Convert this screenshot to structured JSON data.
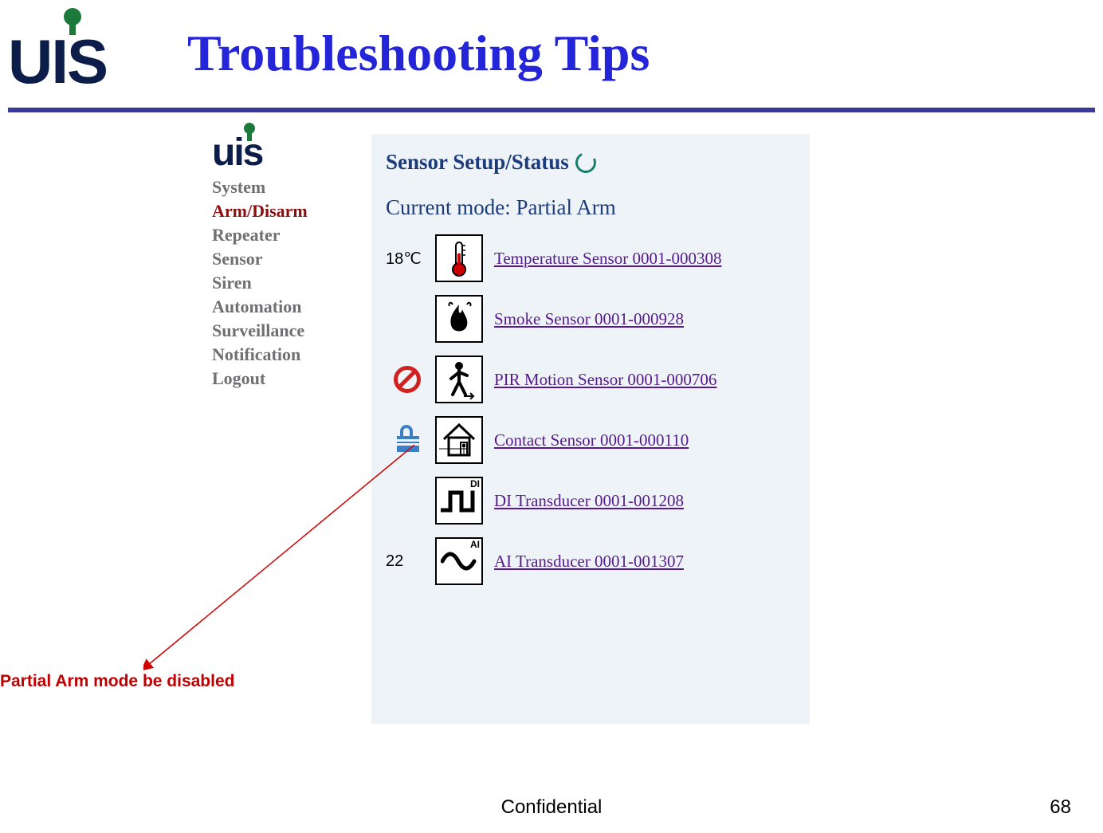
{
  "slide": {
    "title": "Troubleshooting Tips",
    "logo_text": "UIS",
    "footer_confidential": "Confidential",
    "page_number": "68"
  },
  "annotation": {
    "text": "Partial Arm mode be disabled"
  },
  "app": {
    "logo_text": "uis",
    "sidebar": {
      "items": [
        {
          "label": "System",
          "active": false
        },
        {
          "label": "Arm/Disarm",
          "active": true
        },
        {
          "label": "Repeater",
          "active": false
        },
        {
          "label": "Sensor",
          "active": false
        },
        {
          "label": "Siren",
          "active": false
        },
        {
          "label": "Automation",
          "active": false
        },
        {
          "label": "Surveillance",
          "active": false
        },
        {
          "label": "Notification",
          "active": false
        },
        {
          "label": "Logout",
          "active": false
        }
      ]
    },
    "panel": {
      "title": "Sensor Setup/Status",
      "mode_line": "Current mode: Partial Arm",
      "sensors": [
        {
          "status_text": "18℃",
          "status_icon": "",
          "icon": "thermometer-icon",
          "label": "Temperature Sensor 0001-000308"
        },
        {
          "status_text": "",
          "status_icon": "",
          "icon": "fire-icon",
          "label": "Smoke Sensor 0001-000928"
        },
        {
          "status_text": "",
          "status_icon": "prohibit",
          "icon": "motion-icon",
          "label": "PIR Motion Sensor 0001-000706"
        },
        {
          "status_text": "",
          "status_icon": "lock",
          "icon": "house-icon",
          "label": "Contact Sensor 0001-000110"
        },
        {
          "status_text": "",
          "status_icon": "",
          "icon": "di-icon",
          "label": "DI Transducer 0001-001208"
        },
        {
          "status_text": "22",
          "status_icon": "",
          "icon": "ai-icon",
          "label": "AI Transducer 0001-001307"
        }
      ]
    }
  }
}
